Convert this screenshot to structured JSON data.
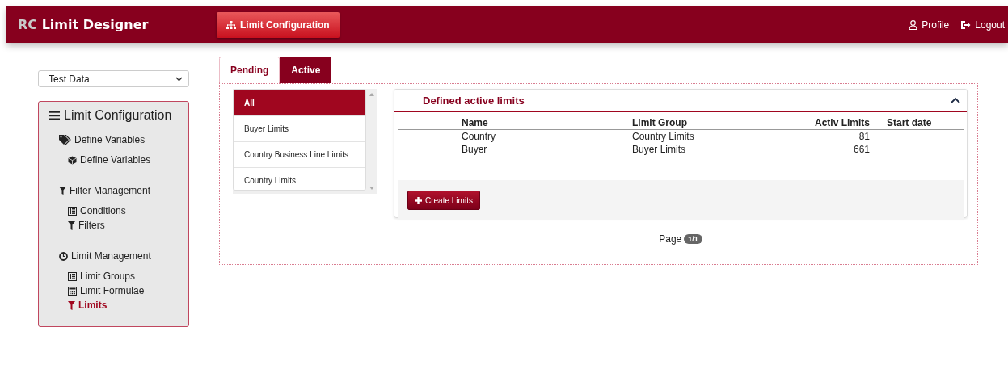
{
  "header": {
    "logo_prefix": "RC",
    "logo_title": "Limit Designer",
    "nav_button": "Limit Configuration",
    "profile": "Profile",
    "logout": "Logout"
  },
  "sidebar": {
    "select_value": "Test Data",
    "title": "Limit Configuration",
    "groups": [
      {
        "label": "Define Variables",
        "children": [
          {
            "label": "Define Variables",
            "selected": false
          }
        ]
      },
      {
        "label": "Filter Management",
        "children": [
          {
            "label": "Conditions",
            "selected": false
          },
          {
            "label": "Filters",
            "selected": false
          }
        ]
      },
      {
        "label": "Limit Management",
        "children": [
          {
            "label": "Limit Groups",
            "selected": false
          },
          {
            "label": "Limit Formulae",
            "selected": false
          },
          {
            "label": "Limits",
            "selected": true
          }
        ]
      }
    ]
  },
  "tabs": [
    {
      "label": "Pending",
      "selected": false
    },
    {
      "label": "Active",
      "selected": true
    }
  ],
  "group_list": [
    {
      "label": "All",
      "selected": true
    },
    {
      "label": "Buyer Limits",
      "selected": false
    },
    {
      "label": "Country Business Line Limits",
      "selected": false
    },
    {
      "label": "Country Limits",
      "selected": false
    }
  ],
  "card": {
    "title": "Defined active limits",
    "columns": [
      "Name",
      "Limit Group",
      "Activ Limits",
      "Start date"
    ],
    "rows": [
      {
        "name": "Country",
        "group": "Country Limits",
        "count": "81"
      },
      {
        "name": "Buyer",
        "group": "Buyer Limits",
        "count": "661"
      }
    ],
    "button": "Create Limits"
  },
  "pagination": {
    "label": "Page",
    "page": "1/1"
  }
}
